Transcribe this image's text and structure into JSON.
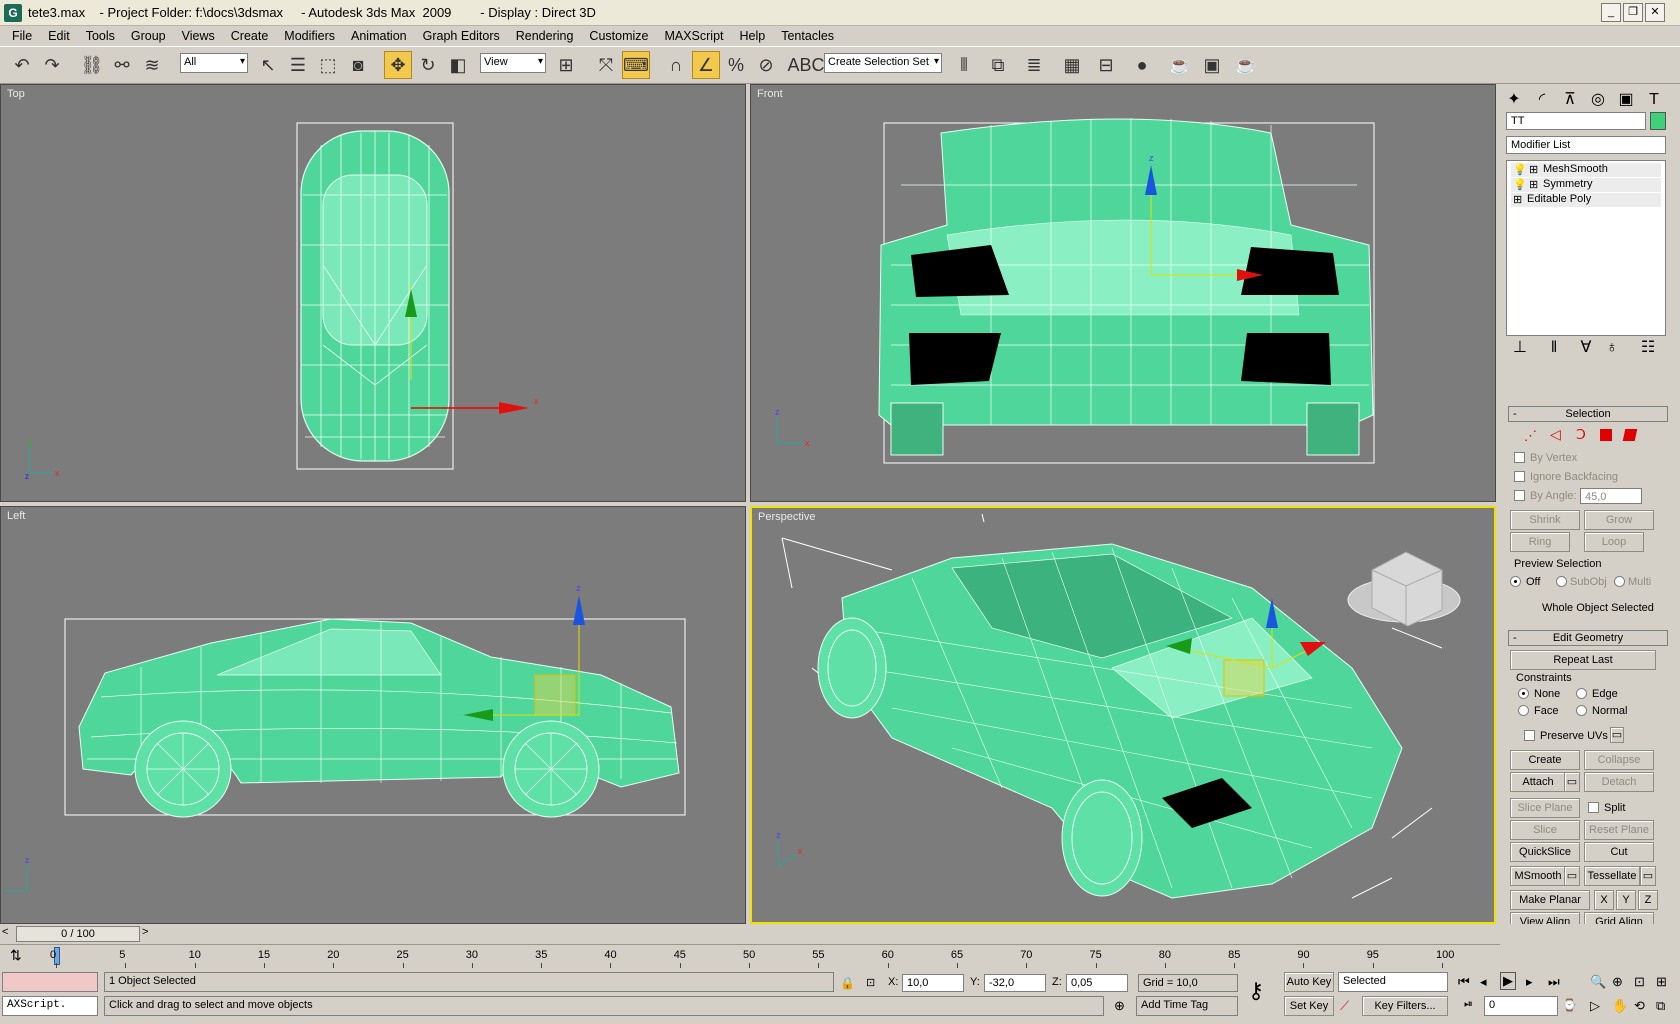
{
  "window": {
    "title": "tete3.max    - Project Folder: f:\\docs\\3dsmax     - Autodesk 3ds Max  2009        - Display : Direct 3D",
    "app_icon": "G",
    "controls": [
      "_",
      "❐",
      "✕"
    ]
  },
  "menu": [
    "File",
    "Edit",
    "Tools",
    "Group",
    "Views",
    "Create",
    "Modifiers",
    "Animation",
    "Graph Editors",
    "Rendering",
    "Customize",
    "MAXScript",
    "Help",
    "Tentacles"
  ],
  "toolbar": {
    "filter_value": "All",
    "coord_value": "View",
    "selection_set_placeholder": "Create Selection Set"
  },
  "viewports": {
    "top": {
      "label": "Top"
    },
    "front": {
      "label": "Front"
    },
    "left": {
      "label": "Left"
    },
    "perspective": {
      "label": "Perspective"
    }
  },
  "panel": {
    "object_name": "TT",
    "object_color": "#3fd07a",
    "modifier_list": "Modifier List",
    "stack": [
      "MeshSmooth",
      "Symmetry",
      "Editable Poly"
    ],
    "selection_title": "Selection",
    "by_vertex": "By Vertex",
    "ignore_backfacing": "Ignore Backfacing",
    "by_angle": "By Angle:",
    "angle_value": "45,0",
    "shrink": "Shrink",
    "grow": "Grow",
    "ring": "Ring",
    "loop": "Loop",
    "preview_selection": "Preview Selection",
    "preview_off": "Off",
    "preview_subobj": "SubObj",
    "preview_multi": "Multi",
    "whole_object": "Whole Object Selected",
    "edit_geometry_title": "Edit Geometry",
    "repeat_last": "Repeat Last",
    "constraints": "Constraints",
    "c_none": "None",
    "c_edge": "Edge",
    "c_face": "Face",
    "c_normal": "Normal",
    "preserve_uvs": "Preserve UVs",
    "create": "Create",
    "collapse": "Collapse",
    "attach": "Attach",
    "detach": "Detach",
    "slice_plane": "Slice Plane",
    "split": "Split",
    "slice": "Slice",
    "reset_plane": "Reset Plane",
    "quickslice": "QuickSlice",
    "cut": "Cut",
    "msmooth": "MSmooth",
    "tessellate": "Tessellate",
    "make_planar": "Make Planar",
    "x": "X",
    "y": "Y",
    "z": "Z",
    "view_align": "View Align",
    "grid_align": "Grid Align"
  },
  "timeline": {
    "slider_text": "0 / 100",
    "ticks": [
      "0",
      "5",
      "10",
      "15",
      "20",
      "25",
      "30",
      "35",
      "40",
      "45",
      "50",
      "55",
      "60",
      "65",
      "70",
      "75",
      "80",
      "85",
      "90",
      "95",
      "100"
    ]
  },
  "status": {
    "script_listener": "AXScript.",
    "selection_status": "1 Object Selected",
    "prompt": "Click and drag to select and move objects",
    "x_label": "X:",
    "x_value": "10,0",
    "y_label": "Y:",
    "y_value": "-32,0",
    "z_label": "Z:",
    "z_value": "0,05",
    "grid": "Grid = 10,0",
    "add_time_tag": "Add Time Tag",
    "auto_key": "Auto Key",
    "set_key": "Set Key",
    "key_mode": "Selected",
    "key_filters": "Key Filters...",
    "frame": "0"
  }
}
